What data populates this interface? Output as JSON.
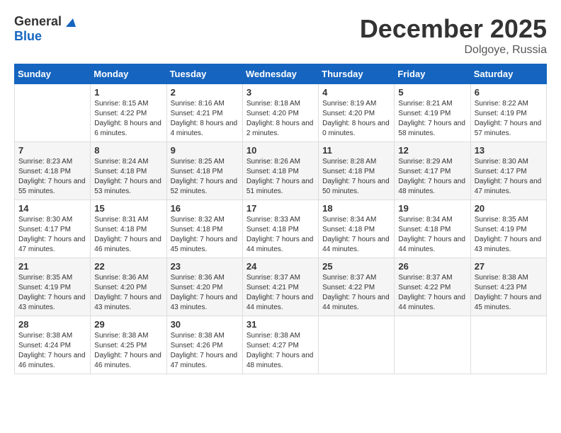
{
  "header": {
    "logo_general": "General",
    "logo_blue": "Blue",
    "month": "December 2025",
    "location": "Dolgoye, Russia"
  },
  "weekdays": [
    "Sunday",
    "Monday",
    "Tuesday",
    "Wednesday",
    "Thursday",
    "Friday",
    "Saturday"
  ],
  "weeks": [
    [
      {
        "day": "",
        "sunrise": "",
        "sunset": "",
        "daylight": ""
      },
      {
        "day": "1",
        "sunrise": "Sunrise: 8:15 AM",
        "sunset": "Sunset: 4:22 PM",
        "daylight": "Daylight: 8 hours and 6 minutes."
      },
      {
        "day": "2",
        "sunrise": "Sunrise: 8:16 AM",
        "sunset": "Sunset: 4:21 PM",
        "daylight": "Daylight: 8 hours and 4 minutes."
      },
      {
        "day": "3",
        "sunrise": "Sunrise: 8:18 AM",
        "sunset": "Sunset: 4:20 PM",
        "daylight": "Daylight: 8 hours and 2 minutes."
      },
      {
        "day": "4",
        "sunrise": "Sunrise: 8:19 AM",
        "sunset": "Sunset: 4:20 PM",
        "daylight": "Daylight: 8 hours and 0 minutes."
      },
      {
        "day": "5",
        "sunrise": "Sunrise: 8:21 AM",
        "sunset": "Sunset: 4:19 PM",
        "daylight": "Daylight: 7 hours and 58 minutes."
      },
      {
        "day": "6",
        "sunrise": "Sunrise: 8:22 AM",
        "sunset": "Sunset: 4:19 PM",
        "daylight": "Daylight: 7 hours and 57 minutes."
      }
    ],
    [
      {
        "day": "7",
        "sunrise": "Sunrise: 8:23 AM",
        "sunset": "Sunset: 4:18 PM",
        "daylight": "Daylight: 7 hours and 55 minutes."
      },
      {
        "day": "8",
        "sunrise": "Sunrise: 8:24 AM",
        "sunset": "Sunset: 4:18 PM",
        "daylight": "Daylight: 7 hours and 53 minutes."
      },
      {
        "day": "9",
        "sunrise": "Sunrise: 8:25 AM",
        "sunset": "Sunset: 4:18 PM",
        "daylight": "Daylight: 7 hours and 52 minutes."
      },
      {
        "day": "10",
        "sunrise": "Sunrise: 8:26 AM",
        "sunset": "Sunset: 4:18 PM",
        "daylight": "Daylight: 7 hours and 51 minutes."
      },
      {
        "day": "11",
        "sunrise": "Sunrise: 8:28 AM",
        "sunset": "Sunset: 4:18 PM",
        "daylight": "Daylight: 7 hours and 50 minutes."
      },
      {
        "day": "12",
        "sunrise": "Sunrise: 8:29 AM",
        "sunset": "Sunset: 4:17 PM",
        "daylight": "Daylight: 7 hours and 48 minutes."
      },
      {
        "day": "13",
        "sunrise": "Sunrise: 8:30 AM",
        "sunset": "Sunset: 4:17 PM",
        "daylight": "Daylight: 7 hours and 47 minutes."
      }
    ],
    [
      {
        "day": "14",
        "sunrise": "Sunrise: 8:30 AM",
        "sunset": "Sunset: 4:17 PM",
        "daylight": "Daylight: 7 hours and 47 minutes."
      },
      {
        "day": "15",
        "sunrise": "Sunrise: 8:31 AM",
        "sunset": "Sunset: 4:18 PM",
        "daylight": "Daylight: 7 hours and 46 minutes."
      },
      {
        "day": "16",
        "sunrise": "Sunrise: 8:32 AM",
        "sunset": "Sunset: 4:18 PM",
        "daylight": "Daylight: 7 hours and 45 minutes."
      },
      {
        "day": "17",
        "sunrise": "Sunrise: 8:33 AM",
        "sunset": "Sunset: 4:18 PM",
        "daylight": "Daylight: 7 hours and 44 minutes."
      },
      {
        "day": "18",
        "sunrise": "Sunrise: 8:34 AM",
        "sunset": "Sunset: 4:18 PM",
        "daylight": "Daylight: 7 hours and 44 minutes."
      },
      {
        "day": "19",
        "sunrise": "Sunrise: 8:34 AM",
        "sunset": "Sunset: 4:18 PM",
        "daylight": "Daylight: 7 hours and 44 minutes."
      },
      {
        "day": "20",
        "sunrise": "Sunrise: 8:35 AM",
        "sunset": "Sunset: 4:19 PM",
        "daylight": "Daylight: 7 hours and 43 minutes."
      }
    ],
    [
      {
        "day": "21",
        "sunrise": "Sunrise: 8:35 AM",
        "sunset": "Sunset: 4:19 PM",
        "daylight": "Daylight: 7 hours and 43 minutes."
      },
      {
        "day": "22",
        "sunrise": "Sunrise: 8:36 AM",
        "sunset": "Sunset: 4:20 PM",
        "daylight": "Daylight: 7 hours and 43 minutes."
      },
      {
        "day": "23",
        "sunrise": "Sunrise: 8:36 AM",
        "sunset": "Sunset: 4:20 PM",
        "daylight": "Daylight: 7 hours and 43 minutes."
      },
      {
        "day": "24",
        "sunrise": "Sunrise: 8:37 AM",
        "sunset": "Sunset: 4:21 PM",
        "daylight": "Daylight: 7 hours and 44 minutes."
      },
      {
        "day": "25",
        "sunrise": "Sunrise: 8:37 AM",
        "sunset": "Sunset: 4:22 PM",
        "daylight": "Daylight: 7 hours and 44 minutes."
      },
      {
        "day": "26",
        "sunrise": "Sunrise: 8:37 AM",
        "sunset": "Sunset: 4:22 PM",
        "daylight": "Daylight: 7 hours and 44 minutes."
      },
      {
        "day": "27",
        "sunrise": "Sunrise: 8:38 AM",
        "sunset": "Sunset: 4:23 PM",
        "daylight": "Daylight: 7 hours and 45 minutes."
      }
    ],
    [
      {
        "day": "28",
        "sunrise": "Sunrise: 8:38 AM",
        "sunset": "Sunset: 4:24 PM",
        "daylight": "Daylight: 7 hours and 46 minutes."
      },
      {
        "day": "29",
        "sunrise": "Sunrise: 8:38 AM",
        "sunset": "Sunset: 4:25 PM",
        "daylight": "Daylight: 7 hours and 46 minutes."
      },
      {
        "day": "30",
        "sunrise": "Sunrise: 8:38 AM",
        "sunset": "Sunset: 4:26 PM",
        "daylight": "Daylight: 7 hours and 47 minutes."
      },
      {
        "day": "31",
        "sunrise": "Sunrise: 8:38 AM",
        "sunset": "Sunset: 4:27 PM",
        "daylight": "Daylight: 7 hours and 48 minutes."
      },
      {
        "day": "",
        "sunrise": "",
        "sunset": "",
        "daylight": ""
      },
      {
        "day": "",
        "sunrise": "",
        "sunset": "",
        "daylight": ""
      },
      {
        "day": "",
        "sunrise": "",
        "sunset": "",
        "daylight": ""
      }
    ]
  ]
}
